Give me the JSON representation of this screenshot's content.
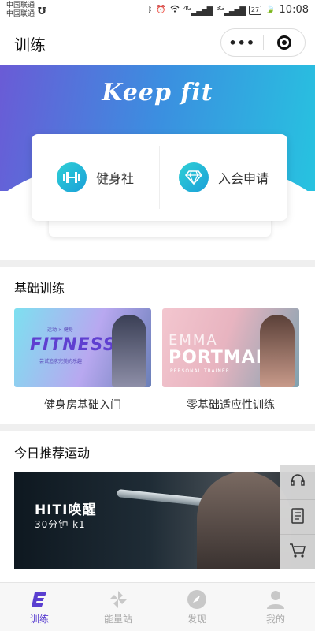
{
  "status_bar": {
    "carrier_1": "中国联通",
    "carrier_2": "中国联通",
    "signal_1_label": "4G",
    "signal_2_label": "3G",
    "battery": "27",
    "time": "10:08"
  },
  "header": {
    "title": "训练",
    "more_label": "•••"
  },
  "hero": {
    "brand": "Keep fit",
    "entries": [
      {
        "label": "健身社",
        "icon": "dumbbell-icon"
      },
      {
        "label": "入会申请",
        "icon": "diamond-icon"
      }
    ]
  },
  "basics": {
    "title": "基础训练",
    "items": [
      {
        "caption": "健身房基础入门",
        "banner_small": "运动 × 健身",
        "banner_big": "FITNESS",
        "banner_sub": "尝试追求完美的乐趣"
      },
      {
        "caption": "零基础适应性训练",
        "banner_top": "EMMA",
        "banner_big": "PORTMAN",
        "banner_sub": "PERSONAL TRAINER"
      }
    ]
  },
  "recommend": {
    "title": "今日推荐运动",
    "banner_title": "HITI唤醒",
    "banner_sub": "30分钟 k1"
  },
  "floating_buttons": [
    "headset-icon",
    "document-icon",
    "cart-icon"
  ],
  "tabs": [
    {
      "label": "训练",
      "icon": "training-icon",
      "active": true
    },
    {
      "label": "能量站",
      "icon": "pinwheel-icon",
      "active": false
    },
    {
      "label": "发现",
      "icon": "compass-icon",
      "active": false
    },
    {
      "label": "我的",
      "icon": "person-icon",
      "active": false
    }
  ],
  "colors": {
    "accent": "#5a3fd0",
    "hero_start": "#6a5bd6",
    "hero_end": "#27c3e0",
    "icon_teal": "#1a9fd8"
  }
}
